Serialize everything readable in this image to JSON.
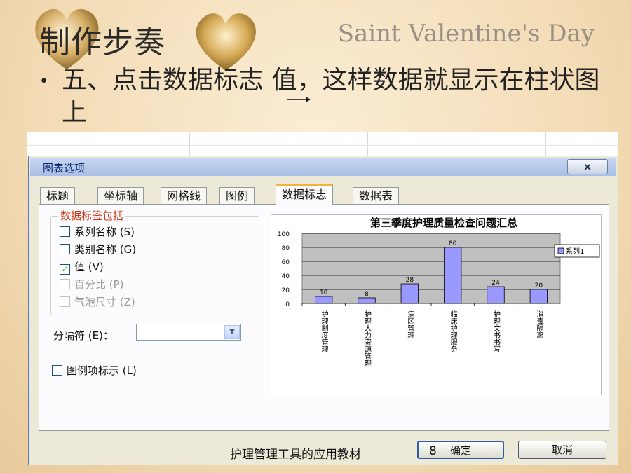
{
  "slide": {
    "title": "制作步奏",
    "brand": "Saint Valentine's Day",
    "bullet": "五、点击数据标志  值，这样数据就显示在柱状图上",
    "footer": "护理管理工具的应用教材",
    "page_number": "8"
  },
  "dialog": {
    "title": "图表选项",
    "close_label": "×",
    "tabs": [
      "标题",
      "坐标轴",
      "网格线",
      "图例",
      "数据标志",
      "数据表"
    ],
    "active_tab": "数据标志",
    "group_label": "数据标签包括",
    "checkboxes": [
      {
        "label": "系列名称 (S)",
        "checked": false,
        "enabled": true
      },
      {
        "label": "类别名称 (G)",
        "checked": false,
        "enabled": true
      },
      {
        "label": "值 (V)",
        "checked": true,
        "enabled": true
      },
      {
        "label": "百分比 (P)",
        "checked": false,
        "enabled": false
      },
      {
        "label": "气泡尺寸 (Z)",
        "checked": false,
        "enabled": false
      }
    ],
    "separator_label": "分隔符 (E)：",
    "separator_value": "",
    "legend_key_label": "图例项标示 (L)",
    "ok_label": "确定",
    "cancel_label": "取消"
  },
  "chart_data": {
    "type": "bar",
    "title": "第三季度护理质量检查问题汇总",
    "categories": [
      "护理制度管理",
      "护理人力资源管理",
      "病区管理",
      "临床护理服务",
      "护理文书书写",
      "消毒隔离"
    ],
    "series": [
      {
        "name": "系列1",
        "values": [
          10,
          8,
          28,
          80,
          24,
          20
        ]
      }
    ],
    "ylim": [
      0,
      100
    ],
    "yticks": [
      0,
      20,
      40,
      60,
      80,
      100
    ],
    "grid": true,
    "legend": "right",
    "bar_color": "#9999ff",
    "plot_bg": "#c0c0c0"
  }
}
